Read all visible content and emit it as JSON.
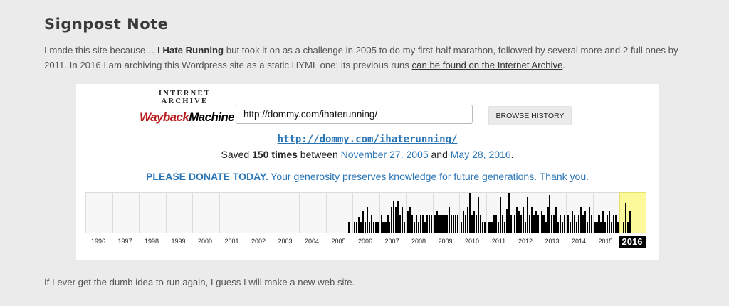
{
  "heading": "Signpost Note",
  "intro": {
    "part1": "I made this site because… ",
    "bold": "I Hate Running",
    "part2": " but took it on as a challenge in 2005 to do my first half marathon, followed by several more and 2 full ones by 2011. In 2016 I am archiving this Wordpress site as a static HYML one; its previous runs ",
    "link": "can be found on the Internet Archive",
    "part3": "."
  },
  "wayback": {
    "logo_top": "INTERNET ARCHIVE",
    "logo_wayback": "WaybackMachine",
    "url_value": "http://dommy.com/ihaterunning/",
    "browse_label": "BROWSE HISTORY",
    "archived_url": "http://dommy.com/ihaterunning/",
    "saved_prefix": "Saved ",
    "saved_count": "150 times",
    "saved_between": " between ",
    "first_date": "November 27, 2005",
    "saved_and": " and ",
    "last_date": "May 28, 2016",
    "saved_end": ".",
    "donate_bold": "PLEASE DONATE TODAY.",
    "donate_rest": " Your generosity preserves knowledge for future generations. Thank you.",
    "selected_year": "2016",
    "accent_color": "#2a75b6",
    "selected_color": "#fcf99a",
    "years": [
      {
        "label": "1996",
        "captures": []
      },
      {
        "label": "1997",
        "captures": []
      },
      {
        "label": "1998",
        "captures": []
      },
      {
        "label": "1999",
        "captures": []
      },
      {
        "label": "2000",
        "captures": []
      },
      {
        "label": "2001",
        "captures": []
      },
      {
        "label": "2002",
        "captures": []
      },
      {
        "label": "2003",
        "captures": []
      },
      {
        "label": "2004",
        "captures": []
      },
      {
        "label": "2005",
        "captures": [
          0,
          0,
          0,
          0,
          0,
          0,
          0,
          0,
          0,
          0,
          0.26,
          0
        ]
      },
      {
        "label": "2006",
        "captures": [
          0.26,
          0.26,
          0.4,
          0.26,
          0.55,
          0.26,
          0.65,
          0.26,
          0.45,
          0.26,
          0.26,
          0.26
        ]
      },
      {
        "label": "2007",
        "captures": [
          0.45,
          0.26,
          0.26,
          0.45,
          0.26,
          0.65,
          0.8,
          0.65,
          0.8,
          0.45,
          0.65,
          0.26
        ]
      },
      {
        "label": "2008",
        "captures": [
          0.55,
          0.65,
          0.45,
          0.26,
          0.45,
          0.26,
          0.45,
          0.45,
          0.26,
          0.45,
          0.45,
          0.45
        ]
      },
      {
        "label": "2009",
        "captures": [
          0.45,
          0.55,
          0.45,
          0.45,
          0.45,
          0.45,
          0.45,
          0.65,
          0.45,
          0.45,
          0.45,
          0.45
        ]
      },
      {
        "label": "2010",
        "captures": [
          0.26,
          0.55,
          0.45,
          0.65,
          1.0,
          0.45,
          0.55,
          0.45,
          0.9,
          0.45,
          0.26,
          0.26
        ]
      },
      {
        "label": "2011",
        "captures": [
          0.26,
          0.26,
          0.26,
          0.45,
          0.45,
          0.26,
          0.9,
          0.45,
          0.26,
          0.6,
          1.0,
          0.45
        ]
      },
      {
        "label": "2012",
        "captures": [
          0.45,
          0.65,
          0.55,
          0.45,
          0.65,
          0.26,
          0.9,
          0.45,
          0.65,
          0.45,
          0.55,
          0.45
        ]
      },
      {
        "label": "2013",
        "captures": [
          0.55,
          0.45,
          0.26,
          0.65,
          0.95,
          0.45,
          0.45,
          0.65,
          0.26,
          0.45,
          0.26,
          0.45
        ]
      },
      {
        "label": "2014",
        "captures": [
          0.45,
          0.26,
          0.55,
          0.45,
          0.26,
          0.45,
          0.65,
          0.45,
          0.55,
          0.26,
          0.65,
          0.45
        ]
      },
      {
        "label": "2015",
        "captures": [
          0.26,
          0.26,
          0.45,
          0.26,
          0.55,
          0.26,
          0.45,
          0.55,
          0.26,
          0.45,
          0.45,
          0.26
        ]
      },
      {
        "label": "2016",
        "captures": [
          0,
          0.26,
          0.75,
          0.26,
          0.55,
          0,
          0,
          0,
          0,
          0,
          0,
          0
        ]
      }
    ]
  },
  "outro": "If I ever get the dumb idea to run again, I guess I will make a new web site."
}
